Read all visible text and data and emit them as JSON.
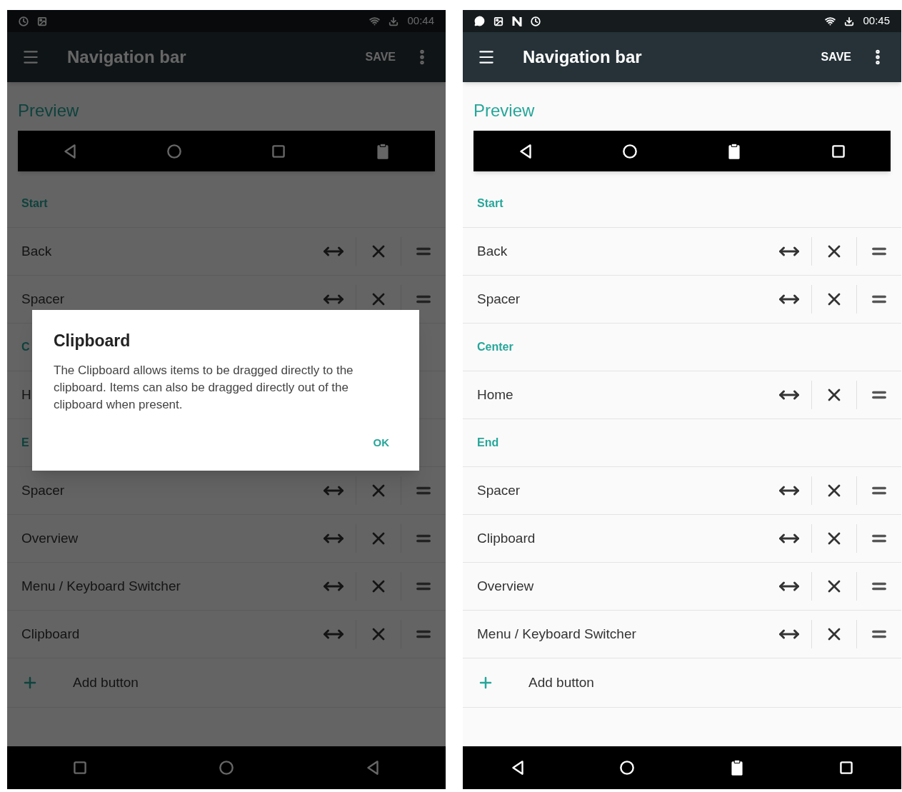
{
  "screens": [
    {
      "dimmed": true,
      "status_bar": {
        "left_icons": [
          {
            "kind": "alarm"
          },
          {
            "kind": "image"
          }
        ],
        "time": "00:44"
      },
      "toolbar": {
        "title": "Navigation bar",
        "action": "SAVE"
      },
      "preview": {
        "label": "Preview",
        "buttons": [
          {
            "kind": "back"
          },
          {
            "kind": "home"
          },
          {
            "kind": "overview"
          },
          {
            "kind": "clipboard"
          }
        ]
      },
      "list": [
        {
          "kind": "header",
          "label": "Start"
        },
        {
          "kind": "item",
          "label": "Back",
          "controls": true
        },
        {
          "kind": "item",
          "label": "Spacer",
          "controls": true
        },
        {
          "kind": "header",
          "label": "C"
        },
        {
          "kind": "item",
          "label": "H",
          "controls": false
        },
        {
          "kind": "header",
          "label": "E"
        },
        {
          "kind": "item",
          "label": "Spacer",
          "controls": true
        },
        {
          "kind": "item",
          "label": "Overview",
          "controls": true
        },
        {
          "kind": "item",
          "label": "Menu / Keyboard Switcher",
          "controls": true
        },
        {
          "kind": "item",
          "label": "Clipboard",
          "controls": true
        }
      ],
      "add_button": "Add button",
      "system_nav": [
        {
          "kind": "overview"
        },
        {
          "kind": "home"
        },
        {
          "kind": "back"
        }
      ],
      "dialog": {
        "title": "Clipboard",
        "message": "The Clipboard allows items to be dragged directly to the clipboard. Items can also be dragged directly out of the clipboard when present.",
        "button": "OK"
      }
    },
    {
      "dimmed": false,
      "status_bar": {
        "left_icons": [
          {
            "kind": "message"
          },
          {
            "kind": "image"
          },
          {
            "kind": "n"
          },
          {
            "kind": "alarm"
          }
        ],
        "time": "00:45"
      },
      "toolbar": {
        "title": "Navigation bar",
        "action": "SAVE"
      },
      "preview": {
        "label": "Preview",
        "buttons": [
          {
            "kind": "back"
          },
          {
            "kind": "home"
          },
          {
            "kind": "clipboard"
          },
          {
            "kind": "overview"
          }
        ]
      },
      "list": [
        {
          "kind": "header",
          "label": "Start"
        },
        {
          "kind": "item",
          "label": "Back",
          "controls": true
        },
        {
          "kind": "item",
          "label": "Spacer",
          "controls": true
        },
        {
          "kind": "header",
          "label": "Center"
        },
        {
          "kind": "item",
          "label": "Home",
          "controls": true
        },
        {
          "kind": "header",
          "label": "End"
        },
        {
          "kind": "item",
          "label": "Spacer",
          "controls": true
        },
        {
          "kind": "item",
          "label": "Clipboard",
          "controls": true
        },
        {
          "kind": "item",
          "label": "Overview",
          "controls": true
        },
        {
          "kind": "item",
          "label": "Menu / Keyboard Switcher",
          "controls": true
        }
      ],
      "add_button": "Add button",
      "system_nav": [
        {
          "kind": "back"
        },
        {
          "kind": "home"
        },
        {
          "kind": "clipboard"
        },
        {
          "kind": "overview"
        }
      ]
    }
  ]
}
